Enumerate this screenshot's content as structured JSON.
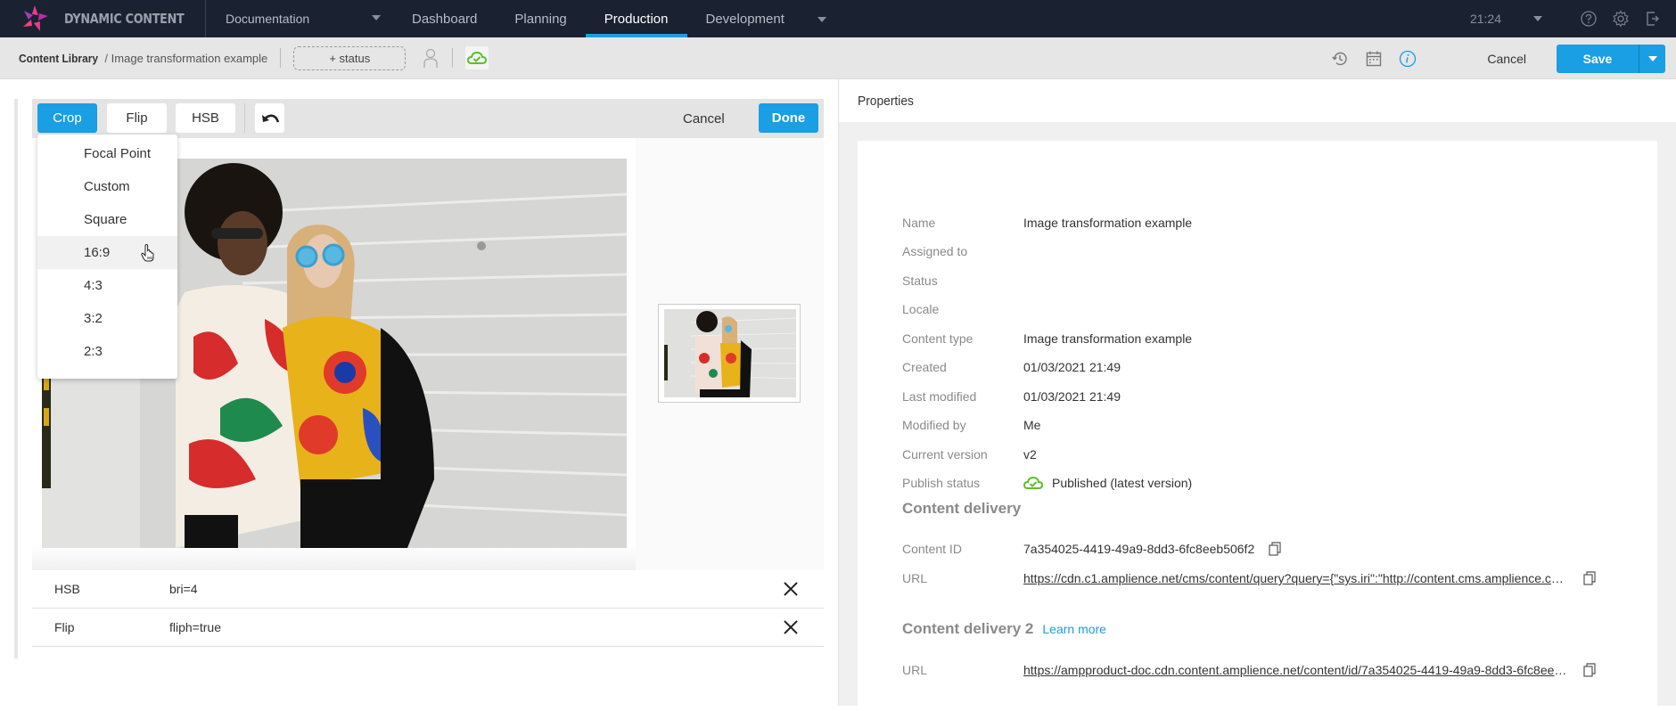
{
  "app": {
    "name": "DYNAMIC CONTENT",
    "hub": "Documentation",
    "nav_tabs": [
      {
        "label": "Dashboard",
        "active": false
      },
      {
        "label": "Planning",
        "active": false
      },
      {
        "label": "Production",
        "active": true
      },
      {
        "label": "Development",
        "active": false
      }
    ],
    "clock": "21:24",
    "accent_color": "#1a9ee4",
    "nav_bg_color": "#1a2130"
  },
  "subbar": {
    "breadcrumb_root": "Content Library",
    "breadcrumb_separator": "/",
    "breadcrumb_current": "Image transformation example",
    "status_button": "+ status",
    "cancel_label": "Cancel",
    "save_label": "Save",
    "icons": [
      "history-icon",
      "calendar-icon",
      "info-icon"
    ]
  },
  "editor": {
    "toolbar": {
      "crop_label": "Crop",
      "flip_label": "Flip",
      "hsb_label": "HSB",
      "cancel_label": "Cancel",
      "done_label": "Done"
    },
    "crop_menu": {
      "items": [
        {
          "label": "Focal Point"
        },
        {
          "label": "Custom"
        },
        {
          "label": "Square"
        },
        {
          "label": "16:9",
          "hovered": true
        },
        {
          "label": "4:3"
        },
        {
          "label": "3:2"
        },
        {
          "label": "2:3"
        }
      ]
    },
    "transformations": [
      {
        "name": "HSB",
        "value": "bri=4"
      },
      {
        "name": "Flip",
        "value": "fliph=true"
      }
    ]
  },
  "properties": {
    "title": "Properties",
    "fields": [
      {
        "label": "Name",
        "value": "Image transformation example"
      },
      {
        "label": "Assigned to",
        "value": ""
      },
      {
        "label": "Status",
        "value": ""
      },
      {
        "label": "Locale",
        "value": ""
      },
      {
        "label": "Content type",
        "value": "Image transformation example"
      },
      {
        "label": "Created",
        "value": "01/03/2021 21:49"
      },
      {
        "label": "Last modified",
        "value": "01/03/2021 21:49"
      },
      {
        "label": "Modified by",
        "value": "Me"
      },
      {
        "label": "Current version",
        "value": "v2"
      },
      {
        "label": "Publish status",
        "value": "Published (latest version)"
      }
    ],
    "publish_color": "#5cbf2a",
    "content_delivery": {
      "title": "Content delivery",
      "content_id_label": "Content ID",
      "content_id": "7a354025-4419-49a9-8dd3-6fc8eeb506f2",
      "url_label": "URL",
      "url": "https://cdn.c1.amplience.net/cms/content/query?query={\"sys.iri\":\"http://content.cms.amplience.co..."
    },
    "content_delivery_2": {
      "title": "Content delivery 2",
      "learn_more": "Learn more",
      "url_label": "URL",
      "url": "https://ampproduct-doc.cdn.content.amplience.net/content/id/7a354025-4419-49a9-8dd3-6fc8eeb..."
    }
  }
}
